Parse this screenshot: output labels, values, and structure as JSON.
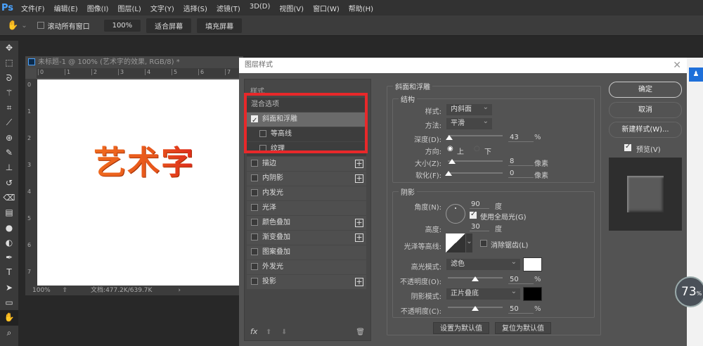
{
  "app": {
    "logo": "Ps",
    "menu": [
      "文件(F)",
      "编辑(E)",
      "图像(I)",
      "图层(L)",
      "文字(Y)",
      "选择(S)",
      "滤镜(T)",
      "3D(D)",
      "视图(V)",
      "窗口(W)",
      "帮助(H)"
    ]
  },
  "options": {
    "scroll_all": "滚动所有窗口",
    "zoom": "100%",
    "fit_screen": "适合屏幕",
    "fill_screen": "填充屏幕"
  },
  "tools": [
    "move-icon",
    "marquee-icon",
    "lasso-icon",
    "magic-wand-icon",
    "crop-icon",
    "eyedropper-icon",
    "healing-icon",
    "brush-icon",
    "stamp-icon",
    "history-brush-icon",
    "eraser-icon",
    "gradient-icon",
    "blur-icon",
    "dodge-icon",
    "pen-icon",
    "type-icon",
    "path-select-icon",
    "rectangle-icon",
    "hand-icon",
    "zoom-icon"
  ],
  "document": {
    "title": "未标题-1 @ 100% (艺术字的效果, RGB/8) *",
    "ruler_ticks": [
      "0",
      "1",
      "2",
      "3",
      "4",
      "5",
      "6",
      "7"
    ],
    "art_text": "艺术字",
    "zoom": "100%",
    "doc_size": "文档:477.2K/639.7K"
  },
  "dialog": {
    "title": "图层样式",
    "styles_header": "样式",
    "blend_options": "混合选项",
    "styles": [
      {
        "label": "斜面和浮雕",
        "checked": true,
        "selected": true,
        "plus": false,
        "sub": false
      },
      {
        "label": "等高线",
        "checked": false,
        "plus": false,
        "sub": true
      },
      {
        "label": "纹理",
        "checked": false,
        "plus": false,
        "sub": true
      },
      {
        "label": "描边",
        "checked": false,
        "plus": true
      },
      {
        "label": "内阴影",
        "checked": false,
        "plus": true
      },
      {
        "label": "内发光",
        "checked": false,
        "plus": false
      },
      {
        "label": "光泽",
        "checked": false,
        "plus": false
      },
      {
        "label": "颜色叠加",
        "checked": false,
        "plus": true
      },
      {
        "label": "渐变叠加",
        "checked": false,
        "plus": true
      },
      {
        "label": "图案叠加",
        "checked": false,
        "plus": false
      },
      {
        "label": "外发光",
        "checked": false,
        "plus": false
      },
      {
        "label": "投影",
        "checked": false,
        "plus": true
      }
    ],
    "bevel": {
      "title": "斜面和浮雕",
      "structure": "结构",
      "style_label": "样式:",
      "style": "内斜面",
      "technique_label": "方法:",
      "technique": "平滑",
      "depth_label": "深度(D):",
      "depth": "43",
      "depth_unit": "%",
      "direction_label": "方向:",
      "up": "上",
      "down": "下",
      "direction": "up",
      "size_label": "大小(Z):",
      "size": "8",
      "size_unit": "像素",
      "soften_label": "软化(F):",
      "soften": "0",
      "soften_unit": "像素"
    },
    "shading": {
      "title": "阴影",
      "angle_label": "角度(N):",
      "angle": "90",
      "angle_unit": "度",
      "global_light": "使用全局光(G)",
      "global_checked": true,
      "altitude_label": "高度:",
      "altitude": "30",
      "altitude_unit": "度",
      "gloss_label": "光泽等高线:",
      "antialias": "消除锯齿(L)",
      "highlight_label": "高光模式:",
      "highlight_mode": "滤色",
      "highlight_color": "#ffffff",
      "hl_opacity_label": "不透明度(O):",
      "hl_opacity": "50",
      "hl_unit": "%",
      "shadow_label": "阴影模式:",
      "shadow_mode": "正片叠底",
      "shadow_color": "#000000",
      "sh_opacity_label": "不透明度(C):",
      "sh_opacity": "50",
      "sh_unit": "%"
    },
    "make_default": "设置为默认值",
    "reset_default": "复位为默认值",
    "ok": "确定",
    "cancel": "取消",
    "new_style": "新建样式(W)...",
    "preview": "预览(V)",
    "fx": "fx"
  },
  "overlay": {
    "percent": "73",
    "unit": "%"
  },
  "accent": "#e8282a"
}
